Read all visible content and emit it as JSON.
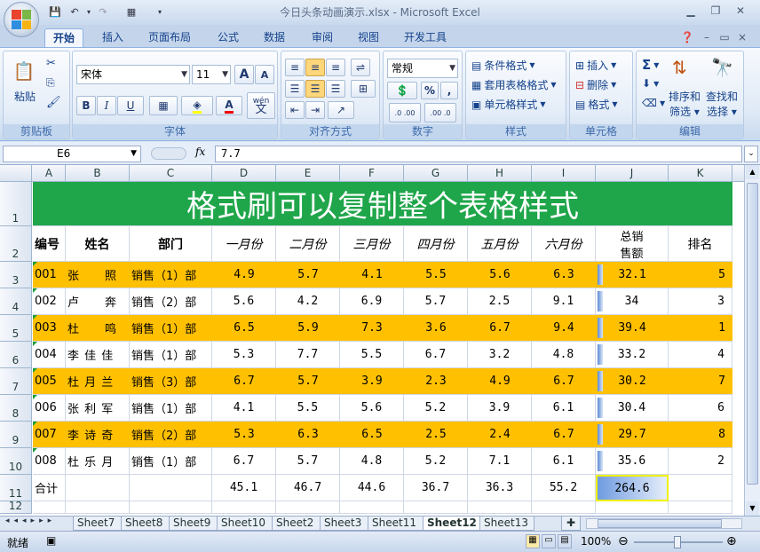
{
  "window": {
    "title": "今日头条动画演示.xlsx - Microsoft Excel"
  },
  "tabs": [
    "开始",
    "插入",
    "页面布局",
    "公式",
    "数据",
    "审阅",
    "视图",
    "开发工具"
  ],
  "ribbon": {
    "clipboard": {
      "paste": "粘贴",
      "label": "剪贴板"
    },
    "font": {
      "name": "宋体",
      "size": "11",
      "bold": "B",
      "italic": "I",
      "underline": "U",
      "grow": "A",
      "shrink": "A",
      "color_a": "A",
      "wen": "wén",
      "wen2": "文",
      "label": "字体"
    },
    "alignment": {
      "label": "对齐方式"
    },
    "number": {
      "format": "常规",
      "percent": "%",
      "comma": ",",
      "inc": ".0 .00",
      "dec": ".00 .0",
      "label": "数字"
    },
    "styles": {
      "cond": "条件格式",
      "table": "套用表格格式",
      "cell": "单元格样式",
      "label": "样式"
    },
    "cells": {
      "insert": "插入",
      "delete": "删除",
      "format": "格式",
      "label": "单元格"
    },
    "editing": {
      "sigma": "Σ",
      "sort": "排序和",
      "sort2": "筛选",
      "find": "查找和",
      "find2": "选择",
      "label": "编辑"
    }
  },
  "formula_bar": {
    "cell_ref": "E6",
    "fx": "fx",
    "value": "7.7"
  },
  "columns": [
    "A",
    "B",
    "C",
    "D",
    "E",
    "F",
    "G",
    "H",
    "I",
    "J",
    "K"
  ],
  "rows": [
    "1",
    "2",
    "3",
    "4",
    "5",
    "6",
    "7",
    "8",
    "9",
    "10",
    "11",
    "12"
  ],
  "sheet": {
    "title": "格式刷可以复制整个表格样式",
    "headers": [
      "编号",
      "姓名",
      "部门",
      "一月份",
      "二月份",
      "三月份",
      "四月份",
      "五月份",
      "六月份",
      "总销\n售额",
      "排名"
    ],
    "data": [
      [
        "001",
        "张　　照",
        "销售（1）部",
        "4.9",
        "5.7",
        "4.1",
        "5.5",
        "5.6",
        "6.3",
        "32.1",
        "5"
      ],
      [
        "002",
        "卢　　奔",
        "销售（2）部",
        "5.6",
        "4.2",
        "6.9",
        "5.7",
        "2.5",
        "9.1",
        "34",
        "3"
      ],
      [
        "003",
        "杜　　鸣",
        "销售（1）部",
        "6.5",
        "5.9",
        "7.3",
        "3.6",
        "6.7",
        "9.4",
        "39.4",
        "1"
      ],
      [
        "004",
        "李 佳 佳",
        "销售（1）部",
        "5.3",
        "7.7",
        "5.5",
        "6.7",
        "3.2",
        "4.8",
        "33.2",
        "4"
      ],
      [
        "005",
        "杜 月 兰",
        "销售（3）部",
        "6.7",
        "5.7",
        "3.9",
        "2.3",
        "4.9",
        "6.7",
        "30.2",
        "7"
      ],
      [
        "006",
        "张 利 军",
        "销售（1）部",
        "4.1",
        "5.5",
        "5.6",
        "5.2",
        "3.9",
        "6.1",
        "30.4",
        "6"
      ],
      [
        "007",
        "李 诗 奇",
        "销售（2）部",
        "5.3",
        "6.3",
        "6.5",
        "2.5",
        "2.4",
        "6.7",
        "29.7",
        "8"
      ],
      [
        "008",
        "杜 乐 月",
        "销售（1）部",
        "6.7",
        "5.7",
        "4.8",
        "5.2",
        "7.1",
        "6.1",
        "35.6",
        "2"
      ]
    ],
    "total": [
      "合计",
      "",
      "",
      "45.1",
      "46.7",
      "44.6",
      "36.7",
      "36.3",
      "55.2",
      "264.6",
      ""
    ],
    "colors": {
      "title_bg": "#1fa64a",
      "stripe": "#ffc000",
      "title_fg": "#ffffff"
    }
  },
  "sheet_tabs": [
    "Sheet7",
    "Sheet8",
    "Sheet9",
    "Sheet10",
    "Sheet2",
    "Sheet3",
    "Sheet11",
    "Sheet12",
    "Sheet13"
  ],
  "active_sheet": "Sheet12",
  "status": {
    "ready": "就绪",
    "zoom": "100%"
  }
}
